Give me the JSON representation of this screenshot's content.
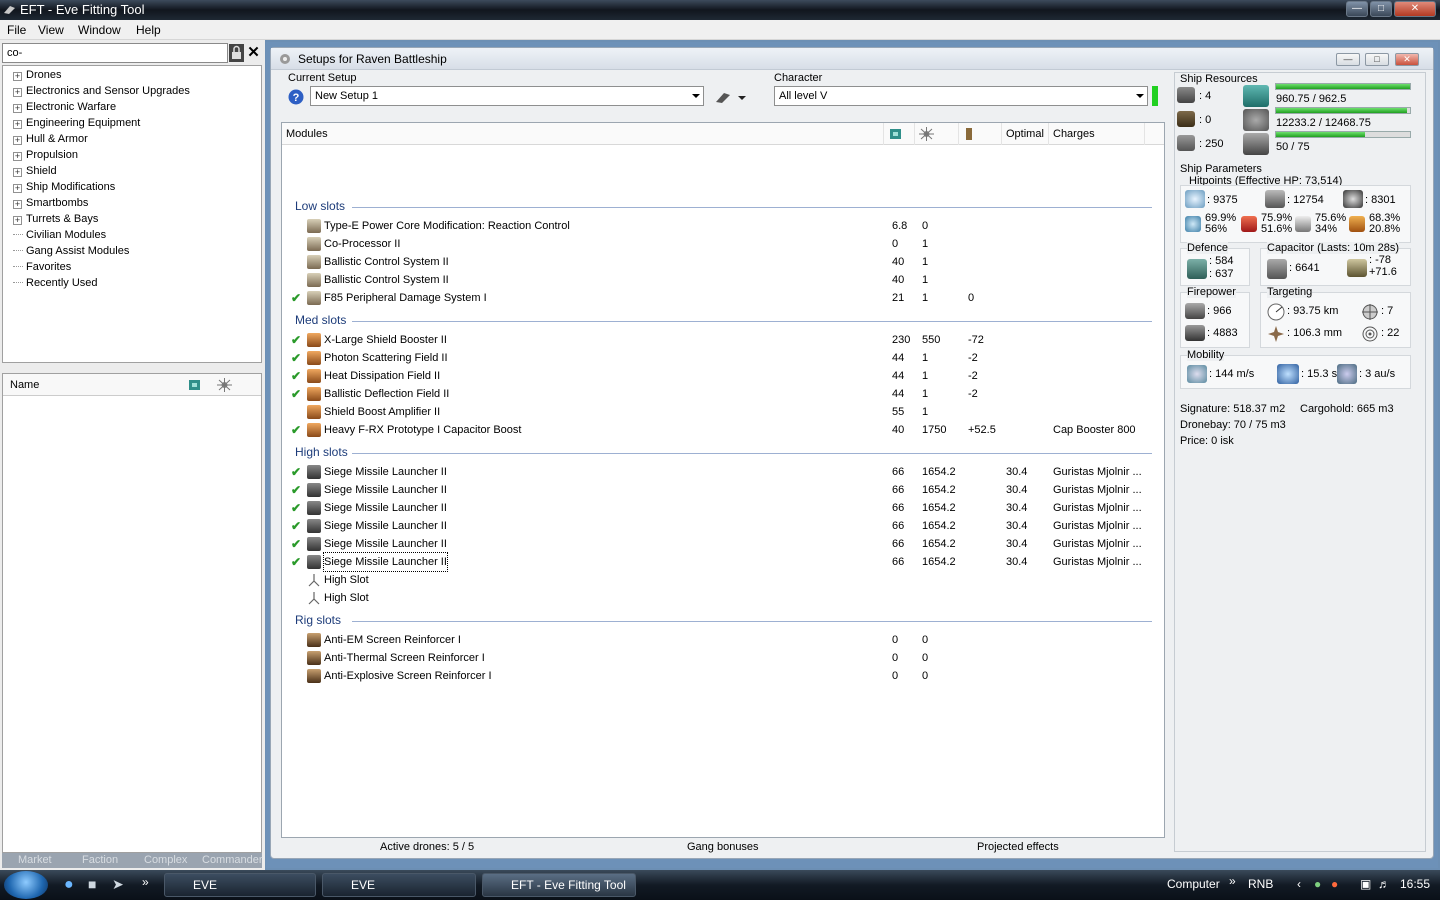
{
  "app": {
    "title": "EFT - Eve Fitting Tool"
  },
  "menu": [
    "File",
    "View",
    "Window",
    "Help"
  ],
  "search": {
    "value": "co-"
  },
  "tree": {
    "groups": [
      "Drones",
      "Electronics and Sensor Upgrades",
      "Electronic Warfare",
      "Engineering Equipment",
      "Hull & Armor",
      "Propulsion",
      "Shield",
      "Ship Modifications",
      "Smartbombs",
      "Turrets & Bays"
    ],
    "leaves": [
      "Civilian Modules",
      "Gang Assist Modules",
      "Favorites",
      "Recently Used"
    ]
  },
  "list": {
    "name_header": "Name"
  },
  "left_tabs": [
    "Market",
    "Faction",
    "Complex",
    "Commander"
  ],
  "window": {
    "title": "Setups for Raven Battleship"
  },
  "setup": {
    "label": "Current Setup",
    "value": "New Setup 1"
  },
  "character": {
    "label": "Character",
    "value": "All level V"
  },
  "modules": {
    "headers": {
      "modules": "Modules",
      "optimal": "Optimal",
      "charges": "Charges"
    },
    "sections": {
      "low": "Low slots",
      "med": "Med slots",
      "high": "High slots",
      "rig": "Rig slots"
    },
    "low": [
      {
        "check": "",
        "name": "Type-E Power Core Modification: Reaction Control",
        "cpu": "6.8",
        "pg": "0",
        "cap": "",
        "optimal": "",
        "charges": ""
      },
      {
        "check": "",
        "name": "Co-Processor II",
        "cpu": "0",
        "pg": "1",
        "cap": "",
        "optimal": "",
        "charges": ""
      },
      {
        "check": "",
        "name": "Ballistic Control System II",
        "cpu": "40",
        "pg": "1",
        "cap": "",
        "optimal": "",
        "charges": ""
      },
      {
        "check": "",
        "name": "Ballistic Control System II",
        "cpu": "40",
        "pg": "1",
        "cap": "",
        "optimal": "",
        "charges": ""
      },
      {
        "check": "✔",
        "name": "F85 Peripheral Damage System I",
        "cpu": "21",
        "pg": "1",
        "cap": "0",
        "optimal": "",
        "charges": ""
      }
    ],
    "med": [
      {
        "check": "✔",
        "name": "X-Large Shield Booster II",
        "cpu": "230",
        "pg": "550",
        "cap": "-72",
        "optimal": "",
        "charges": ""
      },
      {
        "check": "✔",
        "name": "Photon Scattering Field II",
        "cpu": "44",
        "pg": "1",
        "cap": "-2",
        "optimal": "",
        "charges": ""
      },
      {
        "check": "✔",
        "name": "Heat Dissipation Field II",
        "cpu": "44",
        "pg": "1",
        "cap": "-2",
        "optimal": "",
        "charges": ""
      },
      {
        "check": "✔",
        "name": "Ballistic Deflection Field II",
        "cpu": "44",
        "pg": "1",
        "cap": "-2",
        "optimal": "",
        "charges": ""
      },
      {
        "check": "",
        "name": "Shield Boost Amplifier II",
        "cpu": "55",
        "pg": "1",
        "cap": "",
        "optimal": "",
        "charges": ""
      },
      {
        "check": "✔",
        "name": "Heavy F-RX Prototype I Capacitor Boost",
        "cpu": "40",
        "pg": "1750",
        "cap": "+52.5",
        "optimal": "",
        "charges": "Cap Booster 800"
      }
    ],
    "high": [
      {
        "check": "✔",
        "name": "Siege Missile Launcher II",
        "cpu": "66",
        "pg": "1654.2",
        "cap": "",
        "optimal": "30.4",
        "charges": "Guristas Mjolnir ..."
      },
      {
        "check": "✔",
        "name": "Siege Missile Launcher II",
        "cpu": "66",
        "pg": "1654.2",
        "cap": "",
        "optimal": "30.4",
        "charges": "Guristas Mjolnir ..."
      },
      {
        "check": "✔",
        "name": "Siege Missile Launcher II",
        "cpu": "66",
        "pg": "1654.2",
        "cap": "",
        "optimal": "30.4",
        "charges": "Guristas Mjolnir ..."
      },
      {
        "check": "✔",
        "name": "Siege Missile Launcher II",
        "cpu": "66",
        "pg": "1654.2",
        "cap": "",
        "optimal": "30.4",
        "charges": "Guristas Mjolnir ..."
      },
      {
        "check": "✔",
        "name": "Siege Missile Launcher II",
        "cpu": "66",
        "pg": "1654.2",
        "cap": "",
        "optimal": "30.4",
        "charges": "Guristas Mjolnir ..."
      },
      {
        "check": "✔",
        "name": "Siege Missile Launcher II",
        "cpu": "66",
        "pg": "1654.2",
        "cap": "",
        "optimal": "30.4",
        "charges": "Guristas Mjolnir ..."
      },
      {
        "check": "",
        "name": "High Slot",
        "cpu": "",
        "pg": "",
        "cap": "",
        "optimal": "",
        "charges": ""
      },
      {
        "check": "",
        "name": "High Slot",
        "cpu": "",
        "pg": "",
        "cap": "",
        "optimal": "",
        "charges": ""
      }
    ],
    "rig": [
      {
        "check": "",
        "name": "Anti-EM Screen Reinforcer I",
        "cpu": "0",
        "pg": "0",
        "cap": "",
        "optimal": "",
        "charges": ""
      },
      {
        "check": "",
        "name": "Anti-Thermal Screen Reinforcer I",
        "cpu": "0",
        "pg": "0",
        "cap": "",
        "optimal": "",
        "charges": ""
      },
      {
        "check": "",
        "name": "Anti-Explosive Screen Reinforcer I",
        "cpu": "0",
        "pg": "0",
        "cap": "",
        "optimal": "",
        "charges": ""
      }
    ]
  },
  "bottom": {
    "drones": "Active drones: 5 / 5",
    "gang": "Gang bonuses",
    "projected": "Projected effects"
  },
  "resources": {
    "title": "Ship Resources",
    "turrets": ": 4",
    "launchers_free": ": 0",
    "calibration": ": 250",
    "cpu": "960.75 / 962.5",
    "cpu_fraction": 0.998,
    "powergrid": "12233.2 / 12468.75",
    "pg_fraction": 0.981,
    "drone_bandwidth": "50 / 75",
    "bw_fraction": 0.667
  },
  "params": {
    "title": "Ship Parameters",
    "hp_title": "Hitpoints (Effective HP: 73,514)",
    "shield_hp": ": 9375",
    "armor_hp": ": 12754",
    "structure_hp": ": 8301",
    "res_em": "69.9%",
    "res_em2": "56%",
    "res_th": "75.9%",
    "res_th2": "51.6%",
    "res_ki": "75.6%",
    "res_ki2": "34%",
    "res_ex": "68.3%",
    "res_ex2": "20.8%",
    "defence_title": "Defence",
    "def1": ": 584",
    "def2": ": 637",
    "cap_title": "Capacitor (Lasts: 10m 28s)",
    "cap_amount": ": 6641",
    "cap_delta1": ": -78",
    "cap_delta2": "+71.6",
    "fire_title": "Firepower",
    "fire1": ": 966",
    "fire2": ": 4883",
    "target_title": "Targeting",
    "range": ": 93.75 km",
    "targets": ": 7",
    "scanres": ": 106.3 mm",
    "sensor": ": 22",
    "mob_title": "Mobility",
    "speed": ": 144 m/s",
    "align": ": 15.3 s",
    "warp": ": 3 au/s",
    "signature": "Signature: 518.37 m2",
    "cargohold": "Cargohold: 665 m3",
    "dronebay": "Dronebay: 70 / 75 m3",
    "price": "Price: 0 isk"
  },
  "taskbar": {
    "items": [
      "EVE",
      "EVE",
      "EFT - Eve Fitting Tool"
    ],
    "computer": "Computer",
    "lang": "RNB",
    "time": "16:55"
  }
}
